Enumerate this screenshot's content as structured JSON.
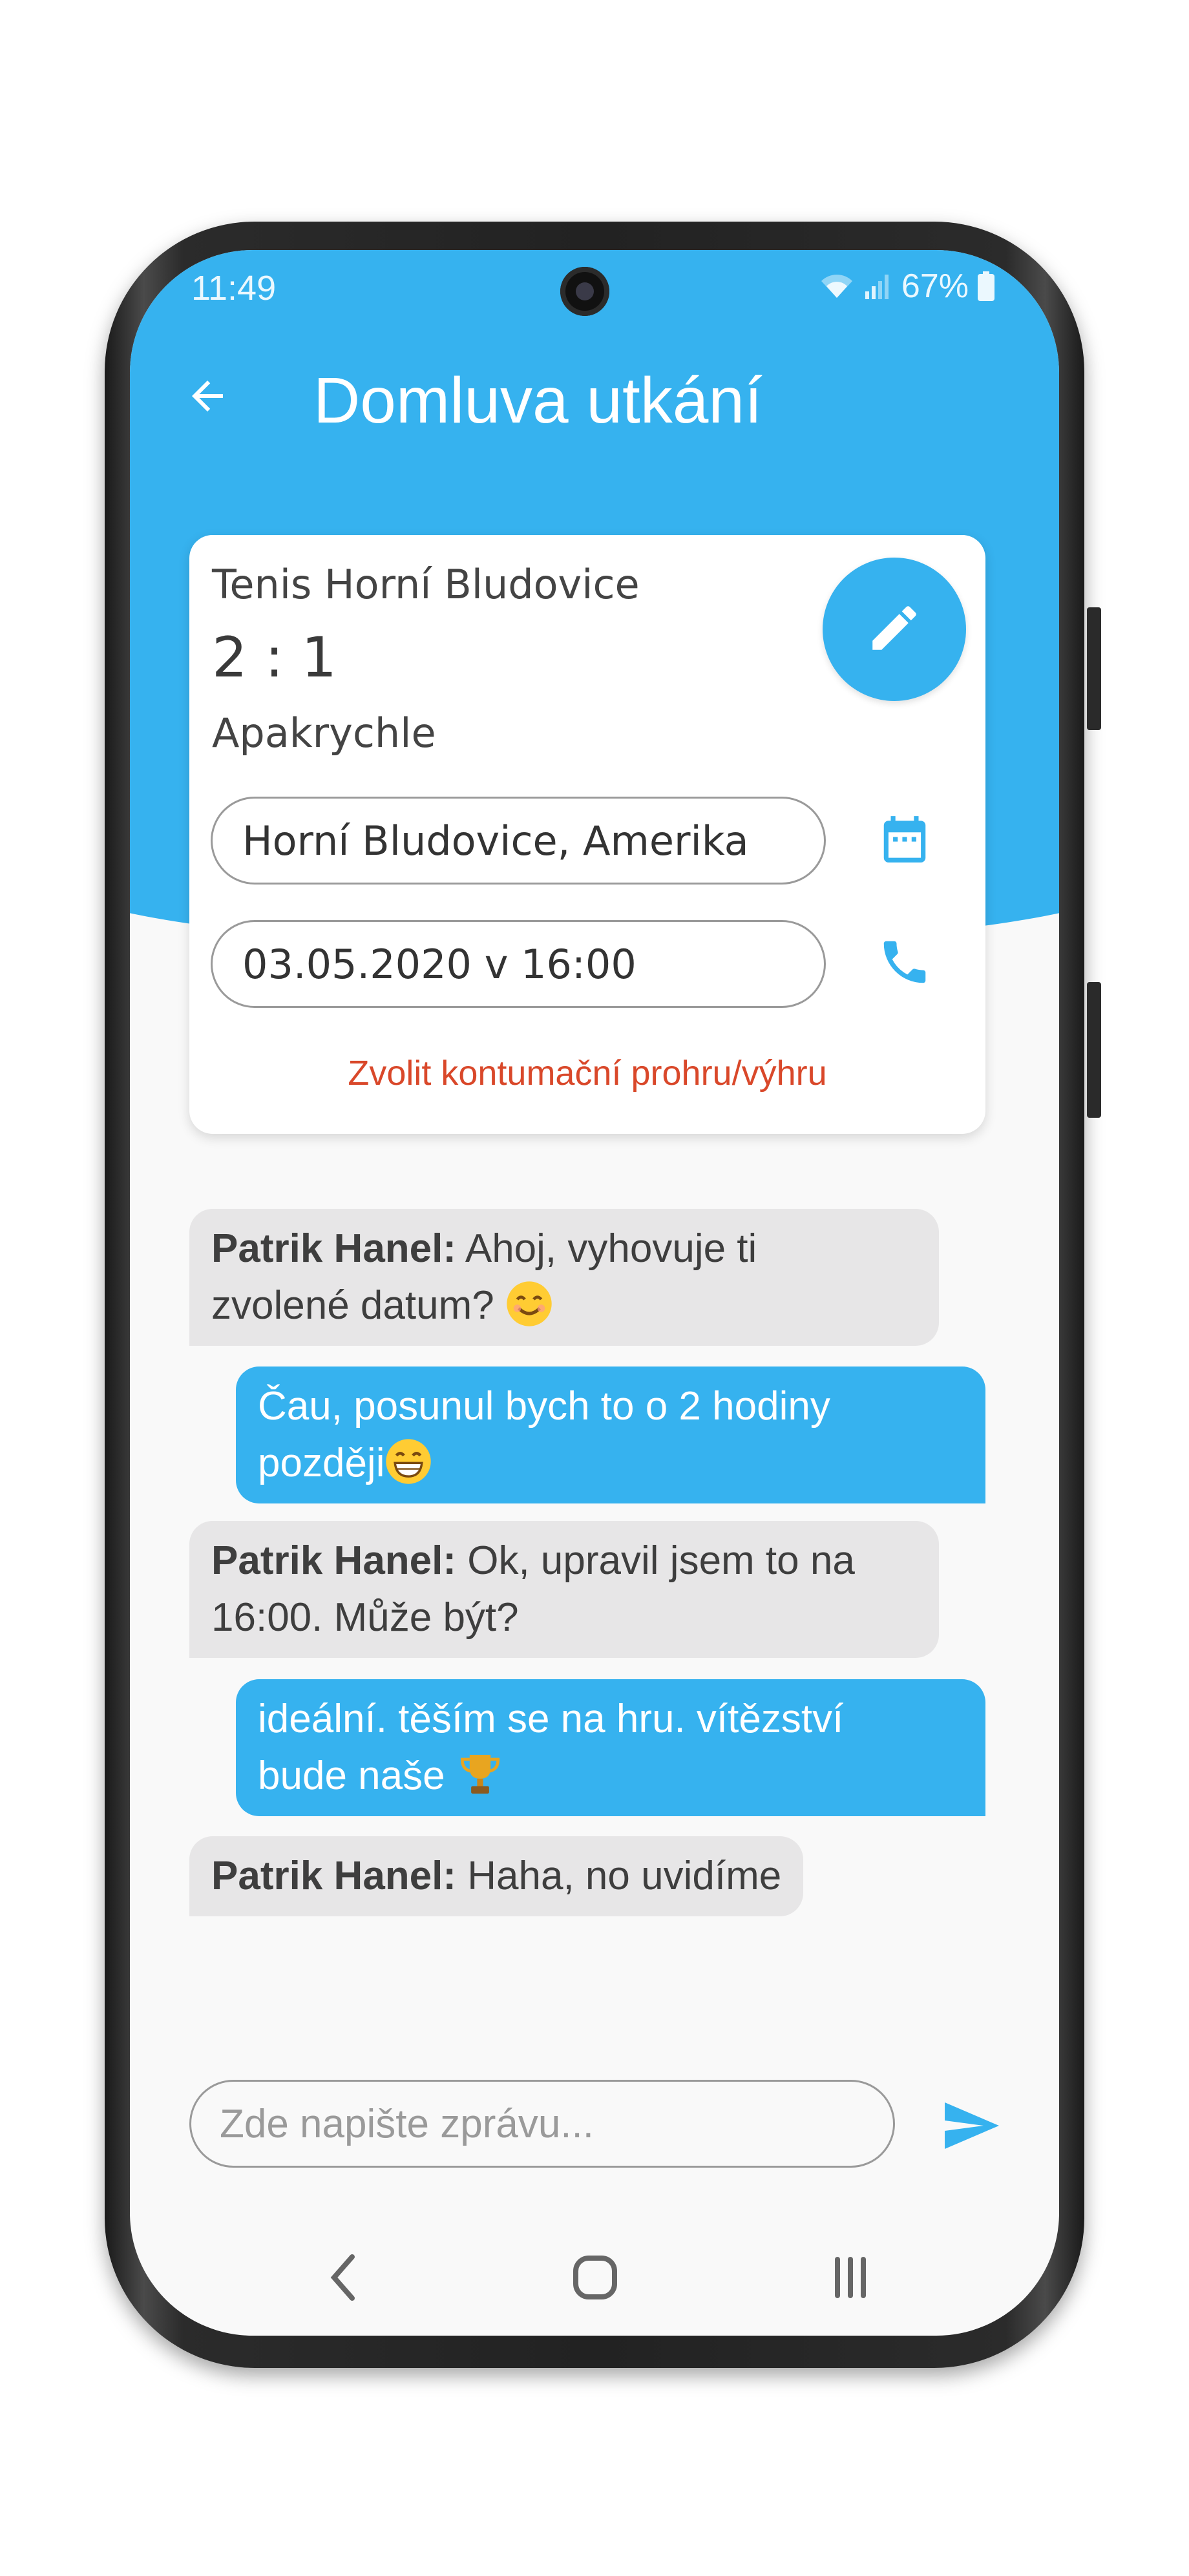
{
  "status_bar": {
    "time": "11:49",
    "battery": "67%"
  },
  "app_bar": {
    "title": "Domluva utkání",
    "back_icon": "arrow-left-icon"
  },
  "match": {
    "home_team": "Tenis Horní Bludovice",
    "score": "2 : 1",
    "away_team": "Apakrychle",
    "place": "Horní Bludovice, Amerika",
    "datetime": "03.05.2020 v 16:00",
    "forfeit_link": "Zvolit kontumační prohru/výhru",
    "edit_icon": "pencil-icon",
    "calendar_icon": "calendar-icon",
    "phone_icon": "phone-icon"
  },
  "chat": {
    "messages": [
      {
        "direction": "in",
        "author": "Patrik Hanel:",
        "text_line1": " Ahoj, vyhovuje ti",
        "text_line2": "zvolené datum? ",
        "emoji": "smiling-face-emoji"
      },
      {
        "direction": "out",
        "text_line1": "Čau, posunul bych to o 2 hodiny",
        "text_line2": "později",
        "emoji": "grinning-face-emoji"
      },
      {
        "direction": "in",
        "author": "Patrik Hanel:",
        "text_line1": " Ok, upravil jsem to na",
        "text_line2": "16:00. Může být?"
      },
      {
        "direction": "out",
        "text_line1": "ideální. těším se na hru. vítězství",
        "text_line2": "bude naše ",
        "emoji": "trophy-emoji"
      },
      {
        "direction": "in",
        "author": "Patrik Hanel:",
        "text_line1": " Haha, no uvidíme"
      }
    ]
  },
  "composer": {
    "placeholder": "Zde napište zprávu...",
    "send_icon": "send-icon"
  },
  "colors": {
    "primary": "#36b2ef",
    "incoming_bubble": "#e7e6e7",
    "link_red": "#d9482a",
    "background": "#f9f9f9"
  }
}
